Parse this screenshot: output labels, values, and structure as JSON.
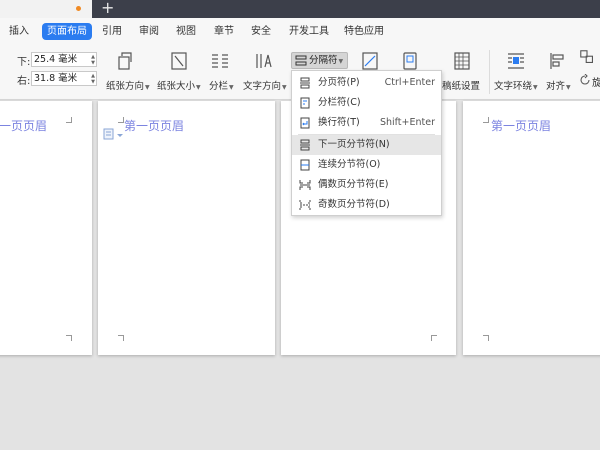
{
  "menubar": {
    "tabs": [
      {
        "label": "插入",
        "active": false
      },
      {
        "label": "页面布局",
        "active": true
      },
      {
        "label": "引用",
        "active": false
      },
      {
        "label": "审阅",
        "active": false
      },
      {
        "label": "视图",
        "active": false
      },
      {
        "label": "章节",
        "active": false
      },
      {
        "label": "安全",
        "active": false
      },
      {
        "label": "开发工具",
        "active": false
      },
      {
        "label": "特色应用",
        "active": false
      }
    ]
  },
  "margins": {
    "bottom_label": "下:",
    "bottom_value": "25.4 毫米",
    "right_label": "右:",
    "right_value": "31.8 毫米"
  },
  "ribbon": {
    "orientation": "纸张方向",
    "size": "纸张大小",
    "columns": "分栏",
    "text_direction": "文字方向",
    "separator": "分隔符",
    "grid_settings": "稿纸设置",
    "text_wrap": "文字环绕",
    "align": "对齐",
    "rotate_partial": "旋"
  },
  "dropdown": {
    "items": [
      {
        "label": "分页符(P)",
        "shortcut": "Ctrl+Enter",
        "icon": "page-break-icon"
      },
      {
        "label": "分栏符(C)",
        "shortcut": "",
        "icon": "column-break-icon"
      },
      {
        "label": "换行符(T)",
        "shortcut": "Shift+Enter",
        "icon": "line-break-icon"
      },
      {
        "label": "下一页分节符(N)",
        "shortcut": "",
        "icon": "next-page-section-icon"
      },
      {
        "label": "连续分节符(O)",
        "shortcut": "",
        "icon": "continuous-section-icon"
      },
      {
        "label": "偶数页分节符(E)",
        "shortcut": "",
        "icon": "even-page-section-icon"
      },
      {
        "label": "奇数页分节符(D)",
        "shortcut": "",
        "icon": "odd-page-section-icon"
      }
    ]
  },
  "document": {
    "header_text": "第一页页眉"
  },
  "colors": {
    "accent": "#2b7cf0",
    "header_text": "#7b83e0",
    "title_bar_dark": "#3c3f4a"
  }
}
